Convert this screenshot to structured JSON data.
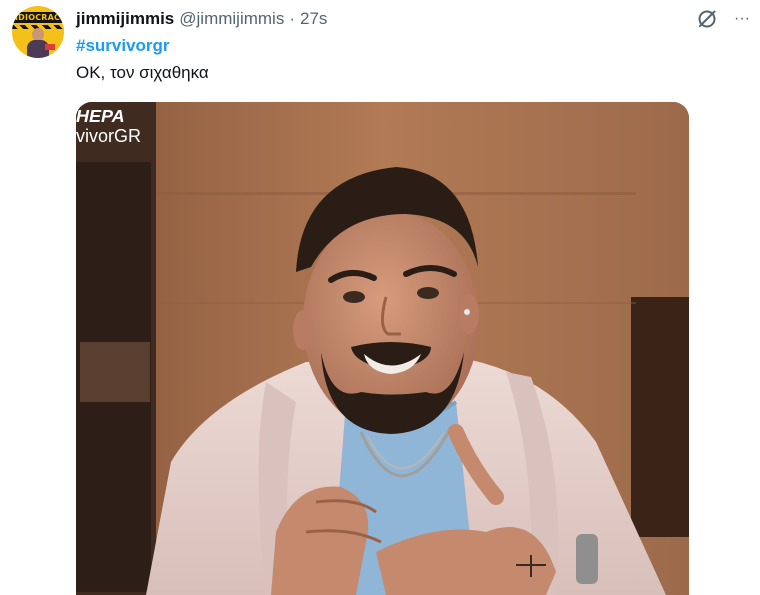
{
  "tweet": {
    "display_name": "jimmijimmis",
    "handle": "@jimmijimmis",
    "separator": "·",
    "time": "27s",
    "hashtag": "#survivorgr",
    "text": "ΟΚ, τον σιχαθηκα",
    "more_label": "···",
    "grok_icon": "grok-icon"
  },
  "avatar": {
    "banner_text": "IDIOCRACY",
    "bg_color": "#f3c11a"
  },
  "media": {
    "watermark_line1": "ΗΕΡΑ",
    "watermark_line2": "vivorGR"
  },
  "colors": {
    "link": "#1d9bf0",
    "secondary": "#536471",
    "text": "#0f1419"
  }
}
